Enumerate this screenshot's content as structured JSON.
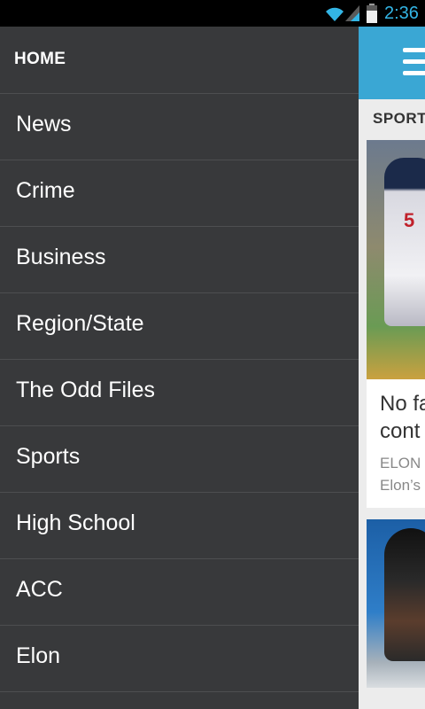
{
  "status_bar": {
    "time": "2:36",
    "accent_color": "#33b5e5",
    "icons": [
      "wifi-icon",
      "signal-icon",
      "battery-icon"
    ]
  },
  "drawer": {
    "header": "HOME",
    "background_color": "#38393b",
    "items": [
      {
        "label": "News"
      },
      {
        "label": "Crime"
      },
      {
        "label": "Business"
      },
      {
        "label": "Region/State"
      },
      {
        "label": "The Odd Files"
      },
      {
        "label": "Sports"
      },
      {
        "label": "High School"
      },
      {
        "label": "ACC"
      },
      {
        "label": "Elon"
      }
    ]
  },
  "content": {
    "action_bar_color": "#3aa7d4",
    "menu_icon": "hamburger-menu-icon",
    "section_label": "SPORT",
    "cards": [
      {
        "headline": "No fa\ncont",
        "tag": "ELON",
        "summary": "Elon’s",
        "jersey_number": "5"
      },
      {}
    ]
  }
}
